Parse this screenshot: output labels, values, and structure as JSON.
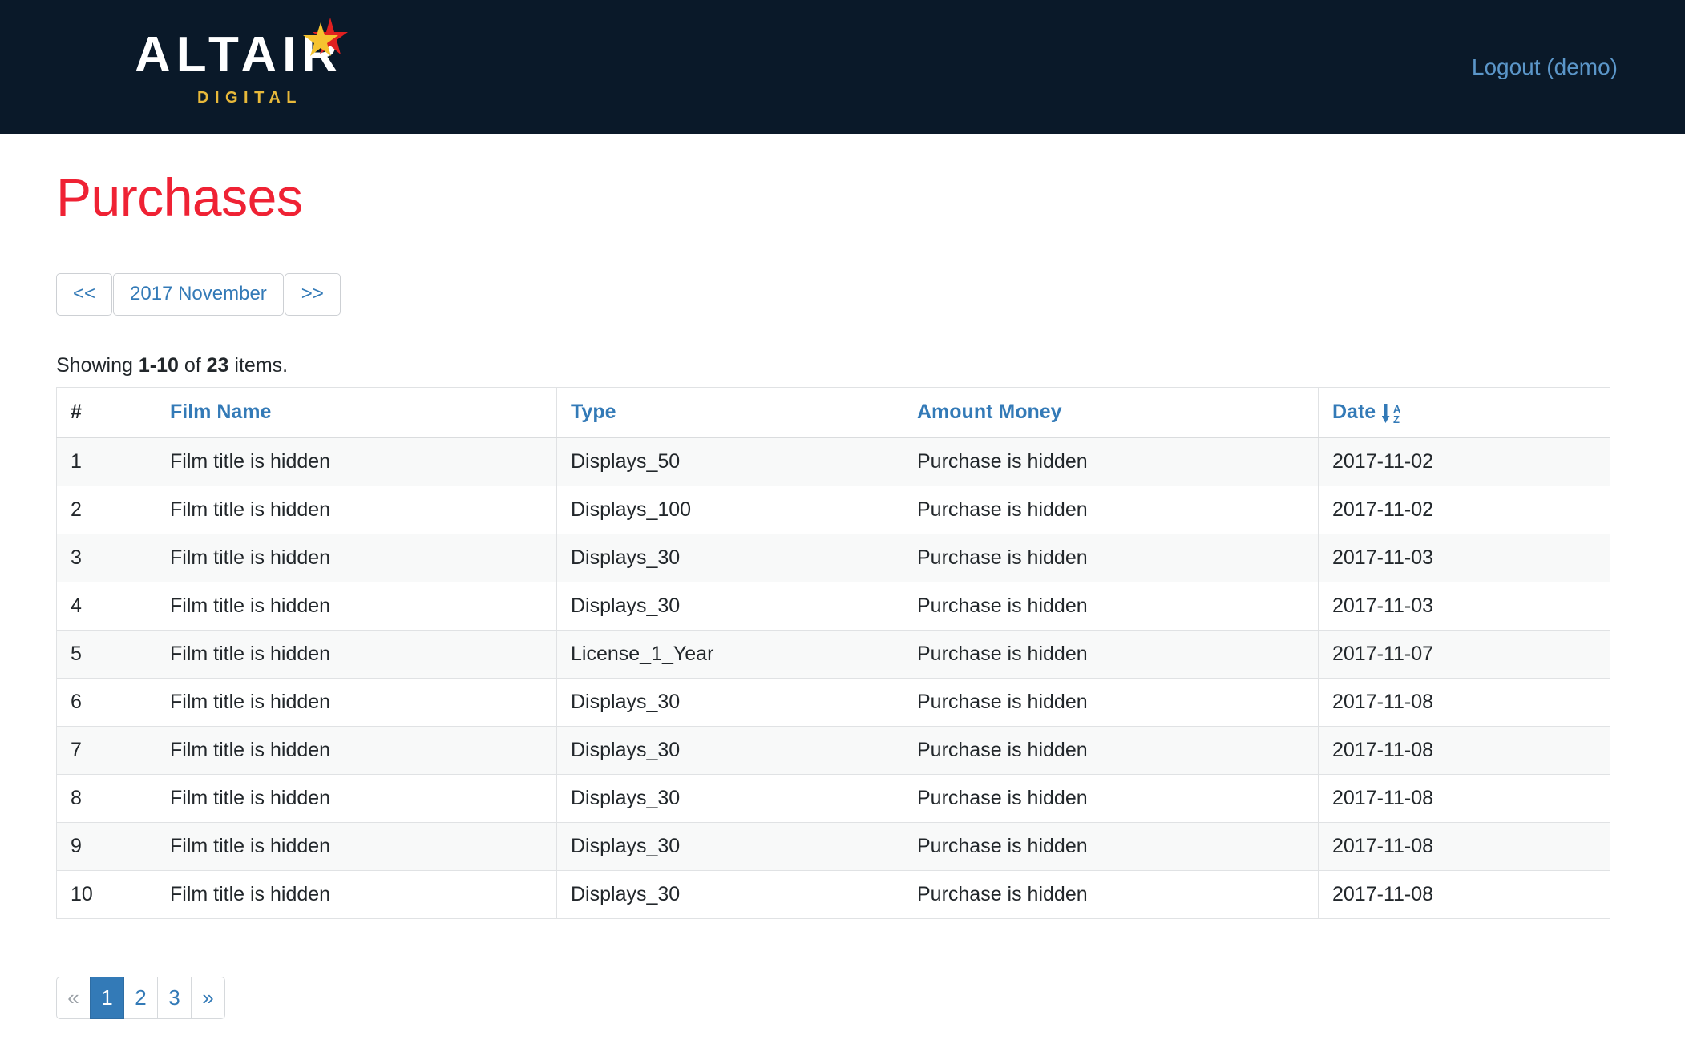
{
  "navbar": {
    "brand_word": "ALTAIR",
    "brand_sub": "DIGITAL",
    "brand_star_icon": "star-icon",
    "logout_label": "Logout (demo)",
    "bg_color": "#0a1929",
    "brand_sub_color": "#e8b93a",
    "link_color": "#5b96c9"
  },
  "page": {
    "title": "Purchases",
    "title_color": "#ef2234"
  },
  "month_nav": {
    "prev_label": "<<",
    "current_label": "2017 November",
    "next_label": ">>"
  },
  "summary": {
    "prefix": "Showing ",
    "range": "1-10",
    "middle": " of ",
    "total": "23",
    "suffix": " items."
  },
  "table": {
    "columns": [
      {
        "key": "num",
        "label": "#",
        "sortable": false
      },
      {
        "key": "film",
        "label": "Film Name",
        "sortable": true
      },
      {
        "key": "type",
        "label": "Type",
        "sortable": true
      },
      {
        "key": "amount",
        "label": "Amount Money",
        "sortable": true
      },
      {
        "key": "date",
        "label": "Date",
        "sortable": true,
        "sort_icon": "sort-alpha-down-icon",
        "sort_dir": "asc"
      }
    ],
    "rows": [
      {
        "num": "1",
        "film": "Film title is hidden",
        "type": "Displays_50",
        "amount": "Purchase is hidden",
        "date": "2017-11-02"
      },
      {
        "num": "2",
        "film": "Film title is hidden",
        "type": "Displays_100",
        "amount": "Purchase is hidden",
        "date": "2017-11-02"
      },
      {
        "num": "3",
        "film": "Film title is hidden",
        "type": "Displays_30",
        "amount": "Purchase is hidden",
        "date": "2017-11-03"
      },
      {
        "num": "4",
        "film": "Film title is hidden",
        "type": "Displays_30",
        "amount": "Purchase is hidden",
        "date": "2017-11-03"
      },
      {
        "num": "5",
        "film": "Film title is hidden",
        "type": "License_1_Year",
        "amount": "Purchase is hidden",
        "date": "2017-11-07"
      },
      {
        "num": "6",
        "film": "Film title is hidden",
        "type": "Displays_30",
        "amount": "Purchase is hidden",
        "date": "2017-11-08"
      },
      {
        "num": "7",
        "film": "Film title is hidden",
        "type": "Displays_30",
        "amount": "Purchase is hidden",
        "date": "2017-11-08"
      },
      {
        "num": "8",
        "film": "Film title is hidden",
        "type": "Displays_30",
        "amount": "Purchase is hidden",
        "date": "2017-11-08"
      },
      {
        "num": "9",
        "film": "Film title is hidden",
        "type": "Displays_30",
        "amount": "Purchase is hidden",
        "date": "2017-11-08"
      },
      {
        "num": "10",
        "film": "Film title is hidden",
        "type": "Displays_30",
        "amount": "Purchase is hidden",
        "date": "2017-11-08"
      }
    ]
  },
  "pagination": {
    "items": [
      {
        "label": "«",
        "name": "pagination-first",
        "state": "disabled"
      },
      {
        "label": "1",
        "name": "pagination-page-1",
        "state": "active"
      },
      {
        "label": "2",
        "name": "pagination-page-2",
        "state": "normal"
      },
      {
        "label": "3",
        "name": "pagination-page-3",
        "state": "normal"
      },
      {
        "label": "»",
        "name": "pagination-next",
        "state": "normal"
      }
    ],
    "active_color": "#337ab7"
  }
}
